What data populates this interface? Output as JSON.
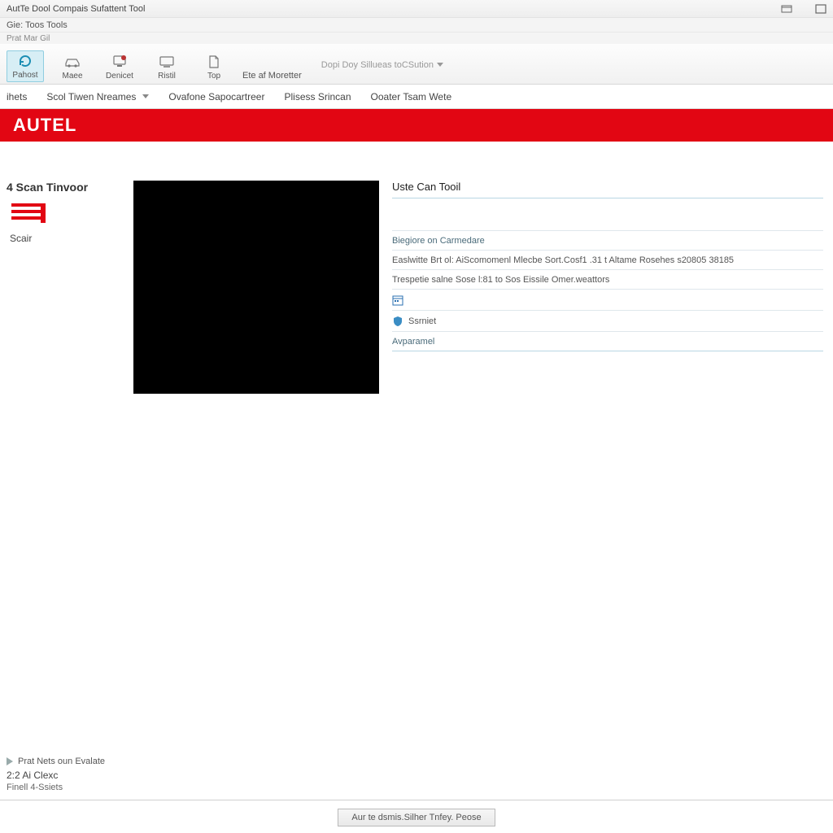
{
  "window": {
    "title": "AutTe Dool Compais Sufattent Tool",
    "menu": "Gie: Toos Tools",
    "path": "Prat Mar Gil"
  },
  "toolbar": {
    "items": [
      {
        "label": "Pahost"
      },
      {
        "label": "Maee"
      },
      {
        "label": "Denicet"
      },
      {
        "label": "Ristil"
      },
      {
        "label": "Top"
      },
      {
        "label": "Ete af Moretter"
      }
    ],
    "dimmed": "Dopi Doy Sillueas toCSution"
  },
  "tabs": [
    {
      "label": "ihets"
    },
    {
      "label": "Scol Tiwen Nreames"
    },
    {
      "label": "Ovafone Sapocartreer"
    },
    {
      "label": "Plisess Srincan"
    },
    {
      "label": "Ooater Tsam Wete"
    }
  ],
  "brand": "AUTEL",
  "section_title": "4 Scan Tinvoor",
  "left_label": "Scair",
  "details": {
    "title": "Uste Can Tooil",
    "diag_label": "Biegiore on Carmedare",
    "line1": "Easlwitte Brt ol: AiScomomenl Mlecbe Sort.Cosf1 .31 t Altame Rosehes s20805 38185",
    "line2": "Trespetie salne Sose l:81 to Sos Eissile Omer.weattors",
    "service": "Ssrniet",
    "approval": "Avparamel"
  },
  "footer": {
    "play": "Prat Nets oun Evalate",
    "version": "2:2 Ai Clexc",
    "final": "Finell 4-Ssiets"
  },
  "status": "Aur te dsmis.Silher Tnfey. Peose"
}
